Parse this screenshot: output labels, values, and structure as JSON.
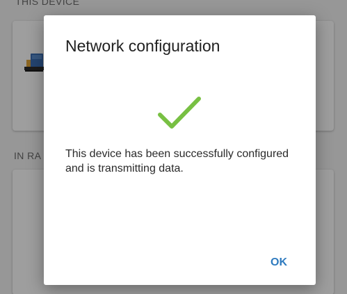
{
  "background": {
    "this_device_label": "THIS DEVICE",
    "in_range_label": "IN RA",
    "device_icon": "computer-device-icon"
  },
  "dialog": {
    "title": "Network configuration",
    "status_icon": "checkmark-icon",
    "message": "This device has been successfully configured and is transmitting data.",
    "ok_label": "OK"
  },
  "colors": {
    "accent": "#2f7bbf",
    "success": "#78c043",
    "device_icon": "#3a6fb5"
  }
}
